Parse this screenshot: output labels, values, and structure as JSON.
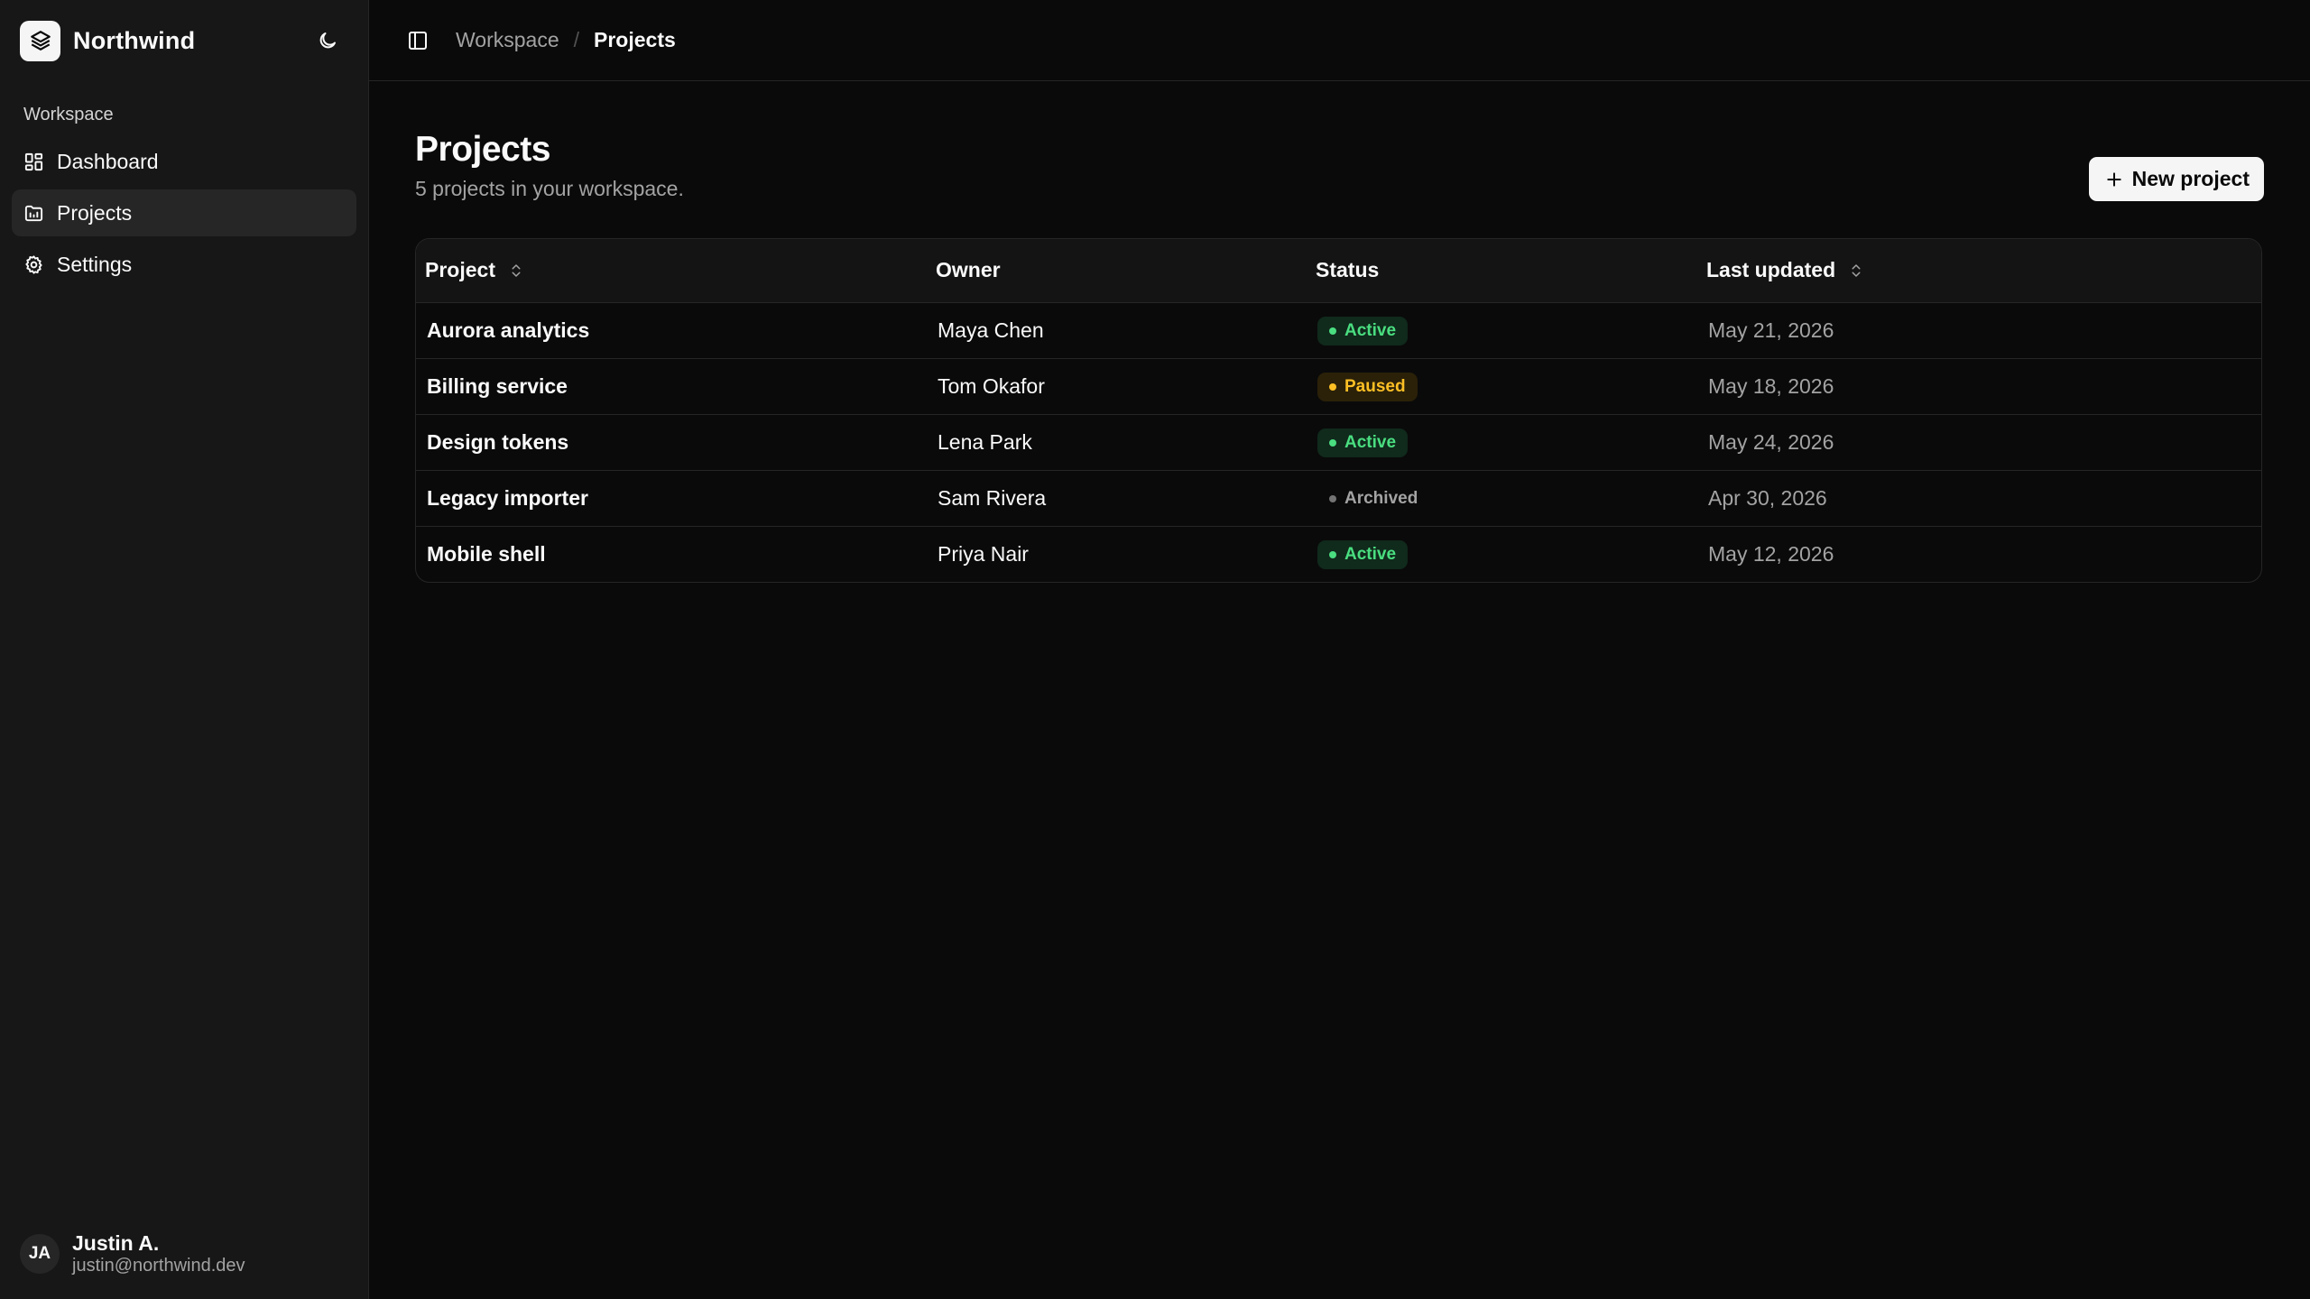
{
  "brand": {
    "name": "Northwind"
  },
  "sidebar": {
    "section_label": "Workspace",
    "items": [
      {
        "label": "Dashboard",
        "icon": "dashboard-icon",
        "active": false
      },
      {
        "label": "Projects",
        "icon": "folder-icon",
        "active": true
      },
      {
        "label": "Settings",
        "icon": "gear-icon",
        "active": false
      }
    ]
  },
  "user": {
    "initials": "JA",
    "name": "Justin A.",
    "email": "justin@northwind.dev"
  },
  "breadcrumb": {
    "parent": "Workspace",
    "separator": "/",
    "current": "Projects"
  },
  "page": {
    "title": "Projects",
    "subtitle": "5 projects in your workspace.",
    "new_button_label": "New project"
  },
  "table": {
    "columns": {
      "project": "Project",
      "owner": "Owner",
      "status": "Status",
      "updated": "Last updated"
    },
    "rows": [
      {
        "project": "Aurora analytics",
        "owner": "Maya Chen",
        "status": "Active",
        "status_kind": "active",
        "updated": "May 21, 2026"
      },
      {
        "project": "Billing service",
        "owner": "Tom Okafor",
        "status": "Paused",
        "status_kind": "paused",
        "updated": "May 18, 2026"
      },
      {
        "project": "Design tokens",
        "owner": "Lena Park",
        "status": "Active",
        "status_kind": "active",
        "updated": "May 24, 2026"
      },
      {
        "project": "Legacy importer",
        "owner": "Sam Rivera",
        "status": "Archived",
        "status_kind": "archived",
        "updated": "Apr 30, 2026"
      },
      {
        "project": "Mobile shell",
        "owner": "Priya Nair",
        "status": "Active",
        "status_kind": "active",
        "updated": "May 12, 2026"
      }
    ]
  },
  "colors": {
    "background": "#0a0a0a",
    "sidebar": "#171717",
    "active_badge": "#4ade80",
    "paused_badge": "#fbbf24",
    "archived_badge": "#a3a3a3"
  }
}
